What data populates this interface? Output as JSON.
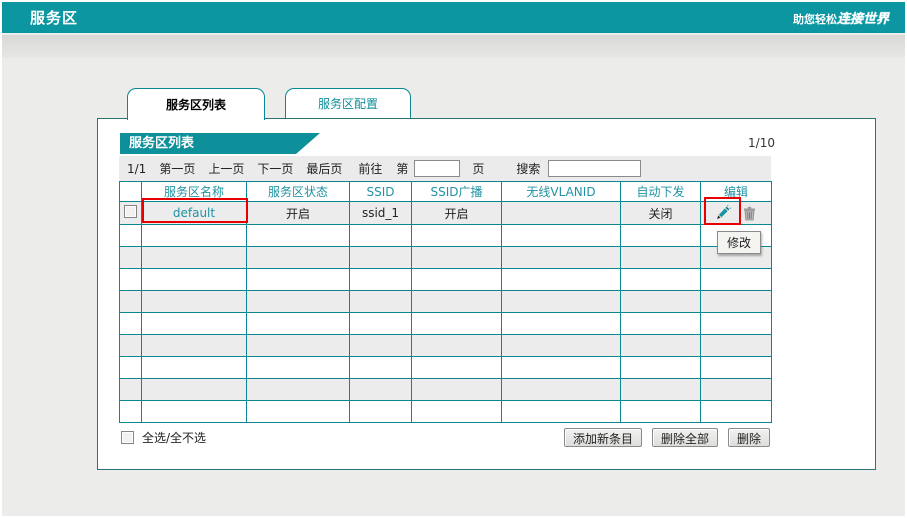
{
  "header": {
    "title": "服务区",
    "slogan_left": "助您轻松",
    "slogan_right": "连接世界"
  },
  "tabs": [
    {
      "label": "服务区列表",
      "active": true
    },
    {
      "label": "服务区配置",
      "active": false
    }
  ],
  "panel": {
    "title": "服务区列表",
    "page_indicator": "1/10"
  },
  "pager": {
    "current": "1/1",
    "first": "第一页",
    "prev": "上一页",
    "next": "下一页",
    "last": "最后页",
    "goto": "前往",
    "page_prefix": "第",
    "page_value": "",
    "page_suffix": "页",
    "search_label": "搜索",
    "search_value": ""
  },
  "table": {
    "columns": [
      "",
      "服务区名称",
      "服务区状态",
      "SSID",
      "SSID广播",
      "无线VLANID",
      "自动下发",
      "编辑"
    ],
    "row": {
      "name": "default",
      "status": "开启",
      "ssid": "ssid_1",
      "broadcast": "开启",
      "vlan": "",
      "auto_deploy": "关闭"
    },
    "empty_rows": 9
  },
  "tooltip": {
    "text": "修改"
  },
  "footer": {
    "select_all": "全选/全不选",
    "add_button": "添加新条目",
    "delete_all_button": "删除全部",
    "delete_button": "删除"
  },
  "icons": {
    "edit": "pencil-icon",
    "delete": "trash-icon"
  },
  "colors": {
    "header_teal": "#0b96a1",
    "titlebar_teal": "#0e909b",
    "table_border": "#0a8794",
    "header_text": "#1f93a3",
    "link": "#1e93a5",
    "annotation_red": "#e80000",
    "alt_row": "#ececec"
  }
}
